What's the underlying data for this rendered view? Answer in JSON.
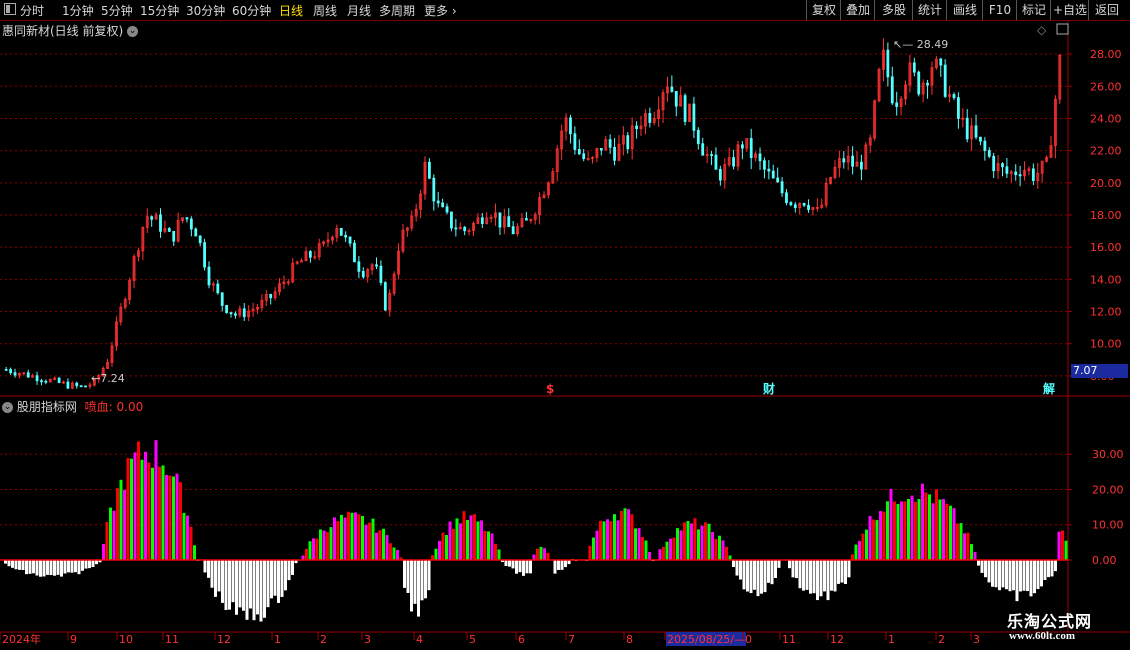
{
  "toolbar": {
    "periods": [
      "分时",
      "1分钟",
      "5分钟",
      "15分钟",
      "30分钟",
      "60分钟",
      "日线",
      "周线",
      "月线",
      "多周期",
      "更多"
    ],
    "active_period": "日线",
    "right_buttons": [
      "复权",
      "叠加",
      "多股",
      "统计",
      "画线",
      "F10",
      "标记",
      "+自选",
      "返回"
    ]
  },
  "main": {
    "title": "惠同新材(日线 前复权)",
    "high_label": "28.49",
    "low_label": "7.24",
    "current_price_tag": "7.07",
    "event_markers": [
      "$",
      "财",
      "解"
    ]
  },
  "indicator": {
    "title": "股朋指标网",
    "value_label": "喷血: 0.00"
  },
  "date_axis": [
    "2024年",
    "9",
    "10",
    "11",
    "12",
    "1",
    "2",
    "3",
    "4",
    "5",
    "6",
    "7",
    "8",
    "2025/08/25/—",
    "0",
    "11",
    "12",
    "1",
    "2",
    "3"
  ],
  "watermark": {
    "line1": "乐淘公式网",
    "line2": "www.60lt.com"
  },
  "colors": {
    "up": "#ff3232",
    "down": "#54ffff",
    "grid": "#8b0000",
    "axis": "#a00000",
    "green": "#00ff00",
    "magenta": "#ff00ff",
    "red": "#ff0000",
    "white": "#ffffff"
  },
  "chart_data": [
    {
      "type": "candlestick",
      "title": "惠同新材(日线 前复权)",
      "y_ticks": [
        8.0,
        10.0,
        12.0,
        14.0,
        16.0,
        18.0,
        20.0,
        22.0,
        24.0,
        26.0,
        28.0
      ],
      "ylim": [
        7.0,
        29.0
      ],
      "x": [
        "2024年",
        "9",
        "10",
        "11",
        "12",
        "1",
        "2",
        "3",
        "4",
        "5",
        "6",
        "7",
        "8",
        "2025/08/25/—",
        "0",
        "11",
        "12",
        "1",
        "2",
        "3"
      ],
      "close_trend": [
        8.4,
        8.2,
        8.0,
        7.8,
        7.6,
        7.4,
        7.3,
        7.6,
        9.0,
        12.0,
        15.0,
        18.0,
        17.5,
        16.5,
        18.0,
        17.0,
        14.0,
        12.5,
        11.8,
        12.0,
        12.4,
        13.0,
        14.0,
        15.0,
        15.5,
        16.0,
        17.5,
        16.0,
        14.5,
        15.0,
        12.0,
        16.5,
        17.5,
        21.0,
        18.5,
        17.5,
        17.0,
        17.5,
        18.5,
        17.5,
        17.0,
        17.5,
        19.0,
        21.0,
        24.0,
        22.0,
        21.0,
        22.5,
        22.0,
        22.5,
        24.0,
        24.5,
        26.5,
        25.0,
        24.0,
        22.0,
        20.5,
        21.0,
        22.5,
        21.5,
        20.5,
        19.5,
        18.8,
        19.0,
        18.0,
        20.5,
        21.5,
        21.0,
        22.0,
        28.0,
        25.0,
        27.0,
        26.0,
        27.5,
        26.0,
        24.0,
        23.0,
        22.0,
        21.0,
        20.5,
        21.0,
        20.5,
        21.0,
        27.5
      ],
      "high": 28.49,
      "low": 7.24
    },
    {
      "type": "bar",
      "title": "股朋指标网",
      "series": [
        {
          "name": "喷血",
          "values": [
            0.0
          ]
        }
      ],
      "y_ticks": [
        0.0,
        10.0,
        20.0,
        30.0
      ],
      "ylim": [
        -17,
        38
      ]
    }
  ]
}
